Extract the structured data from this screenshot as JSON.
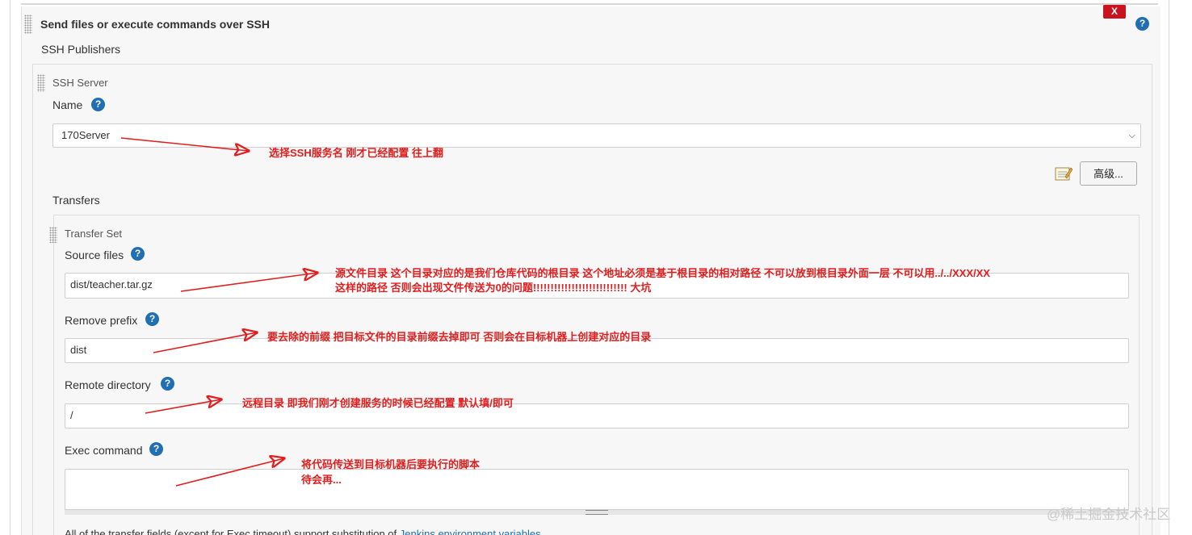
{
  "section": {
    "title": "Send files or execute commands over SSH",
    "close_label": "X",
    "help_label": "?"
  },
  "publishers": {
    "title": "SSH Publishers",
    "server_title": "SSH Server",
    "name_label": "Name",
    "name_value": "170Server",
    "advanced_button": "高级...",
    "transfers_label": "Transfers"
  },
  "transfer_set": {
    "title": "Transfer Set",
    "source_files_label": "Source files",
    "source_files_value": "dist/teacher.tar.gz",
    "remove_prefix_label": "Remove prefix",
    "remove_prefix_value": "dist",
    "remote_directory_label": "Remote directory",
    "remote_directory_value": "/",
    "exec_command_label": "Exec command",
    "exec_command_value": ""
  },
  "annotations": {
    "name_note": "选择SSH服务名 刚才已经配置 往上翻",
    "source_note_line1": "源文件目录  这个目录对应的是我们仓库代码的根目录 这个地址必须是基于根目录的相对路径  不可以放到根目录外面一层 不可以用../../XXX/XX",
    "source_note_line2": "这样的路径 否则会出现文件传送为0的问题!!!!!!!!!!!!!!!!!!!!!!!!!!! 大坑",
    "prefix_note": "要去除的前缀 把目标文件的目录前缀去掉即可 否则会在目标机器上创建对应的目录",
    "remote_note": "远程目录 即我们刚才创建服务的时候已经配置 默认填/即可",
    "exec_note_line1": "将代码传送到目标机器后要执行的脚本",
    "exec_note_line2": "待会再..."
  },
  "footer": {
    "note_prefix": "All of the transfer fields (except for Exec timeout) support substitution of ",
    "note_link": "Jenkins environment variables"
  },
  "watermark": "@稀土掘金技术社区",
  "colors": {
    "annotation_red": "#e11d1d",
    "help_blue": "#1f6fb2",
    "close_red": "#c8141e"
  }
}
